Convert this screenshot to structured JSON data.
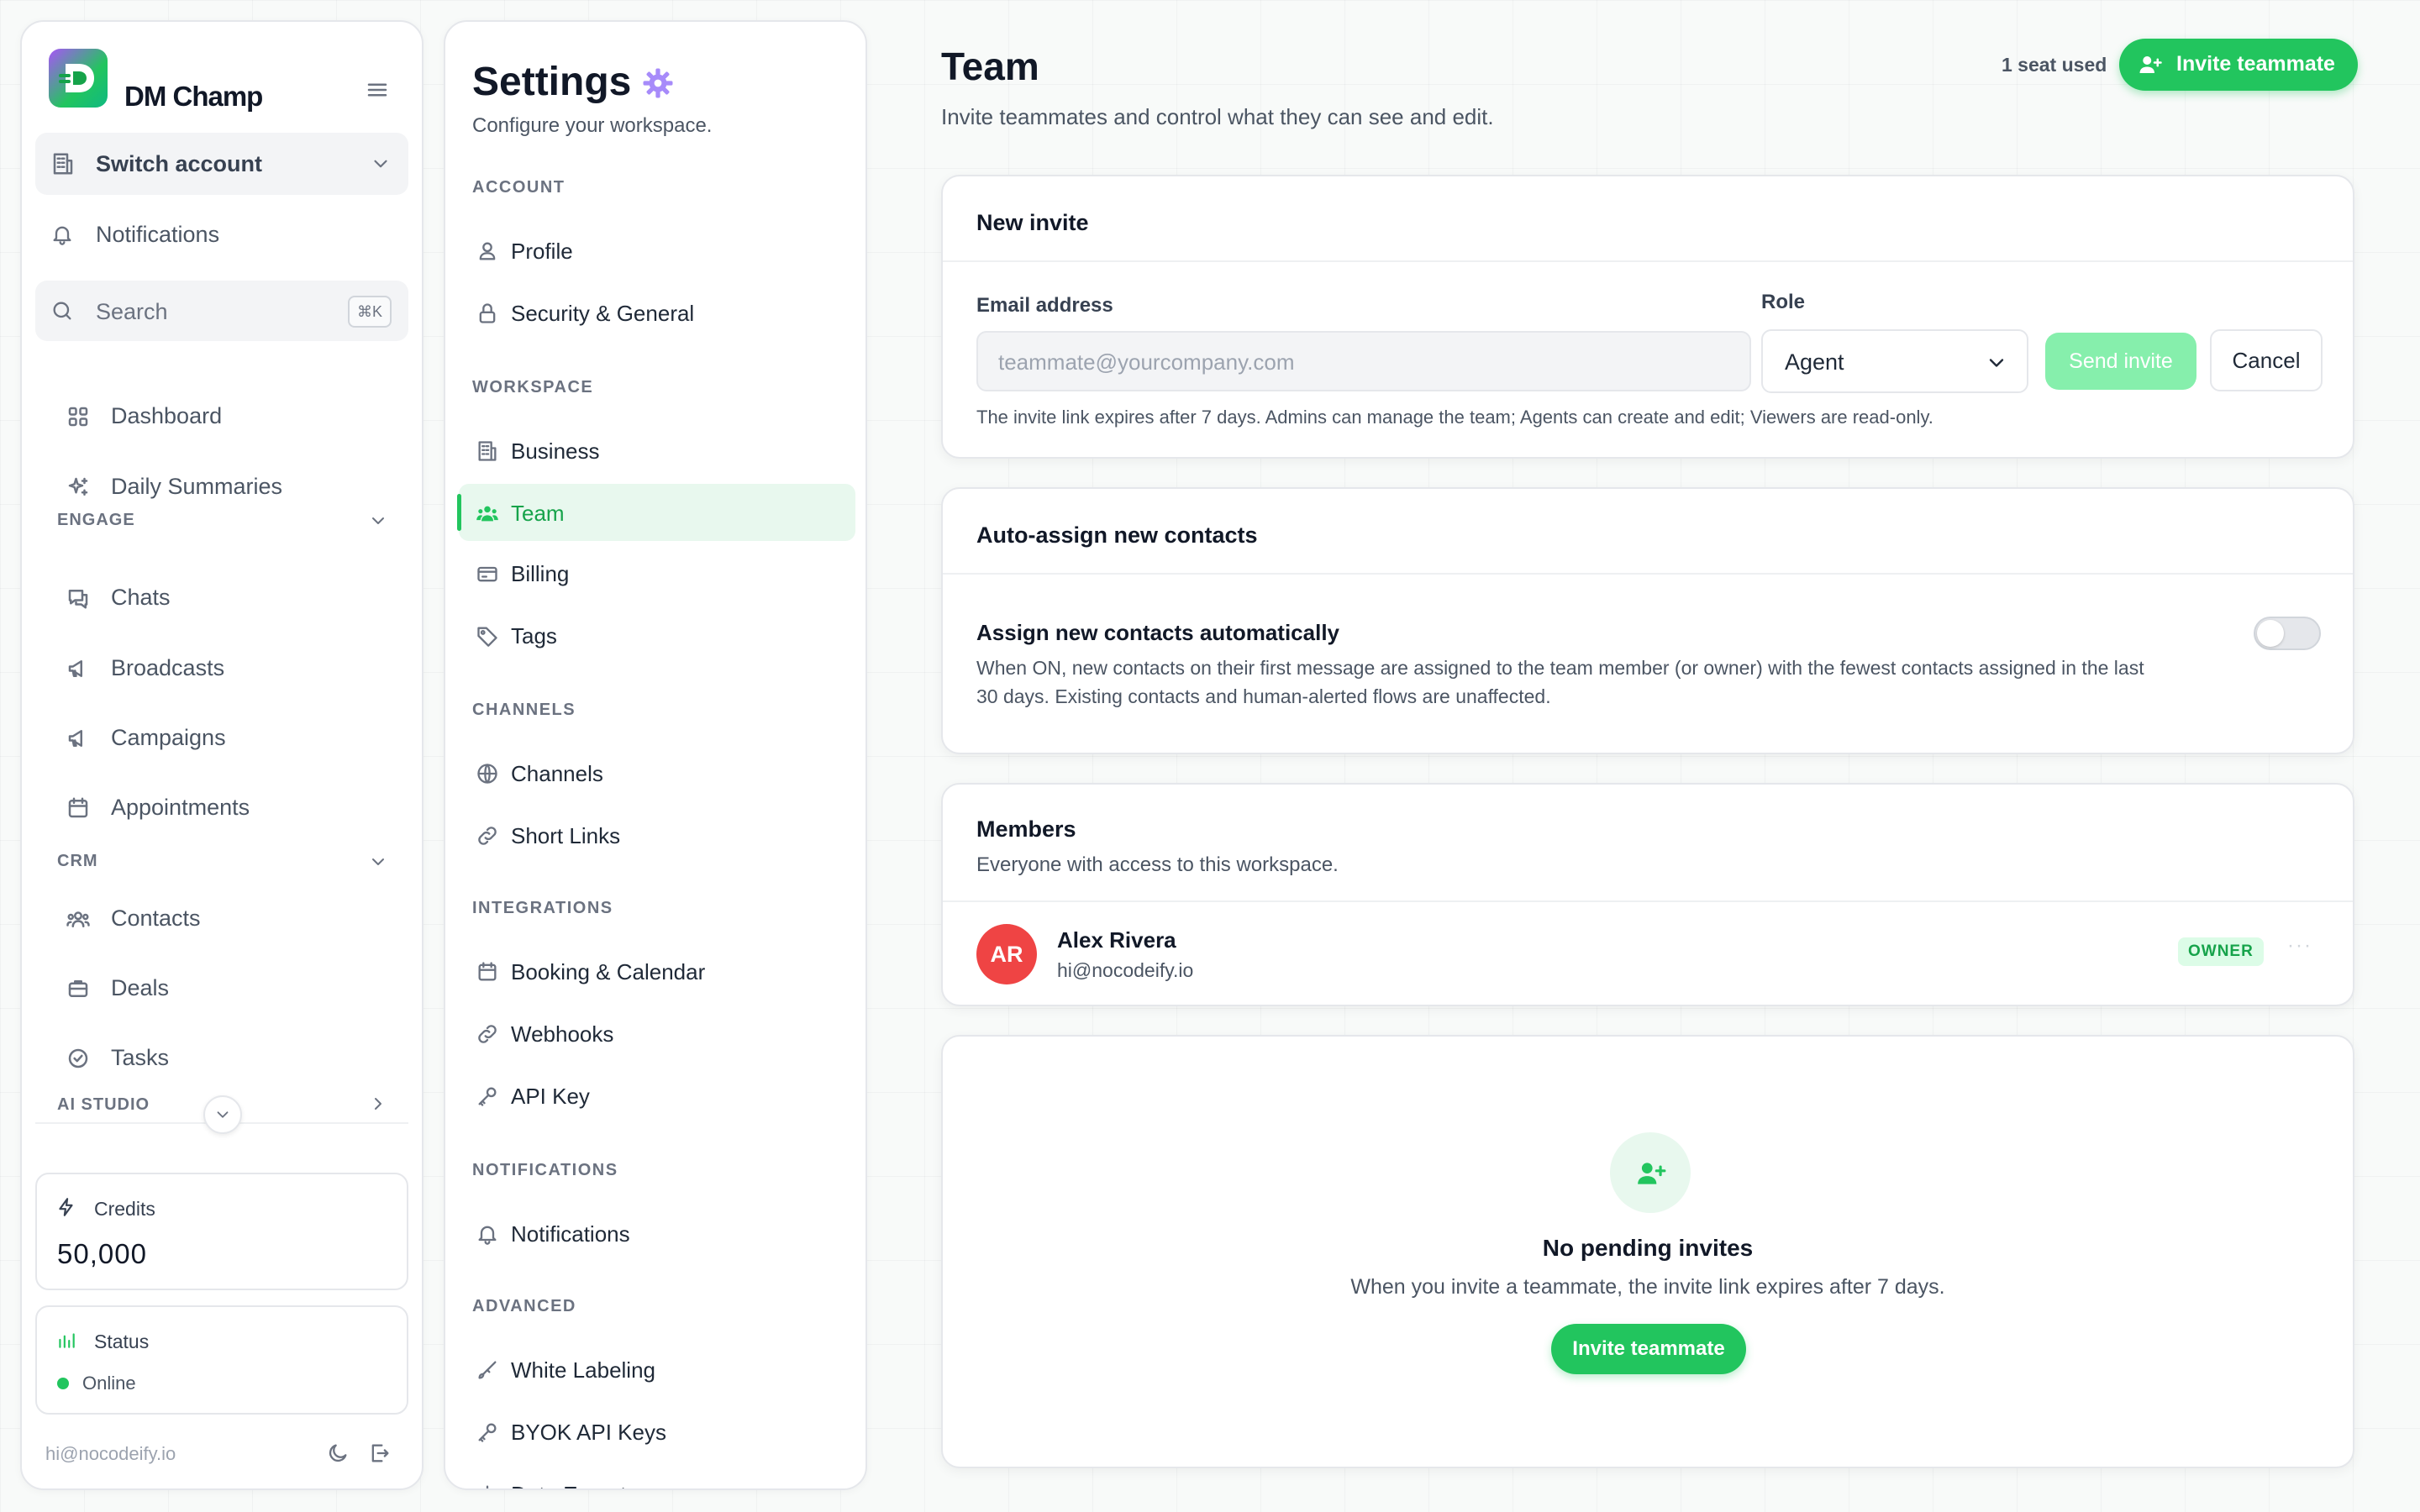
{
  "sidebar": {
    "brand": "DM Champ",
    "switch_account": "Switch account",
    "notifications": "Notifications",
    "search": {
      "label": "Search",
      "shortcut": "⌘K"
    },
    "items": [
      {
        "label": "Dashboard",
        "icon": "grid-icon"
      },
      {
        "label": "Daily Summaries",
        "icon": "sparkles-icon"
      }
    ],
    "sections": [
      {
        "label": "ENGAGE",
        "items": [
          {
            "label": "Chats",
            "icon": "chat-icon"
          },
          {
            "label": "Broadcasts",
            "icon": "megaphone-icon"
          },
          {
            "label": "Campaigns",
            "icon": "megaphone-icon"
          },
          {
            "label": "Appointments",
            "icon": "calendar-icon"
          }
        ]
      },
      {
        "label": "CRM",
        "items": [
          {
            "label": "Contacts",
            "icon": "users-icon"
          },
          {
            "label": "Deals",
            "icon": "briefcase-icon"
          },
          {
            "label": "Tasks",
            "icon": "check-circle-icon"
          }
        ]
      },
      {
        "label": "AI STUDIO",
        "items": []
      }
    ],
    "credits": {
      "label": "Credits",
      "value": "50,000"
    },
    "status": {
      "label": "Status",
      "value": "Online",
      "color": "#22c55e"
    },
    "footer_email": "hi@nocodeify.io"
  },
  "settings_nav": {
    "title": "Settings",
    "subtitle": "Configure your workspace.",
    "sections": [
      {
        "label": "ACCOUNT",
        "items": [
          "Profile",
          "Security & General"
        ]
      },
      {
        "label": "WORKSPACE",
        "items": [
          "Business",
          "Team",
          "Billing",
          "Tags"
        ]
      },
      {
        "label": "CHANNELS",
        "items": [
          "Channels",
          "Short Links"
        ]
      },
      {
        "label": "INTEGRATIONS",
        "items": [
          "Booking & Calendar",
          "Webhooks",
          "API Key"
        ]
      },
      {
        "label": "NOTIFICATIONS",
        "items": [
          "Notifications"
        ]
      },
      {
        "label": "ADVANCED",
        "items": [
          "White Labeling",
          "BYOK API Keys",
          "Data Export"
        ]
      }
    ],
    "active": "Team"
  },
  "header": {
    "title": "Team",
    "subtitle": "Invite teammates and control what they can see and edit.",
    "seats": "1 seat used",
    "invite_button": "Invite teammate"
  },
  "invite": {
    "title": "New invite",
    "email_label": "Email address",
    "email_placeholder": "teammate@yourcompany.com",
    "role_label": "Role",
    "role_value": "Agent",
    "send_button": "Send invite",
    "cancel_button": "Cancel",
    "hint": "The invite link expires after 7 days. Admins can manage the team; Agents can create and edit; Viewers are read-only."
  },
  "auto_assign": {
    "title": "Auto-assign new contacts",
    "toggle_label": "Assign new contacts automatically",
    "description_line1": "When ON, new contacts on their first message are assigned to the team member (or owner) with the fewest contacts assigned in the last",
    "description_line2": "30 days. Existing contacts and human-alerted flows are unaffected.",
    "enabled": false
  },
  "members": {
    "title": "Members",
    "subtitle": "Everyone with access to this workspace.",
    "list": [
      {
        "initials": "AR",
        "name": "Alex Rivera",
        "email": "hi@nocodeify.io",
        "role": "OWNER",
        "avatar_color": "#ef4444"
      }
    ]
  },
  "pending": {
    "title": "No pending invites",
    "subtitle": "When you invite a teammate, the invite link expires after 7 days.",
    "button": "Invite teammate"
  },
  "colors": {
    "accent": "#22c55e",
    "accent_dark": "#16a34a"
  }
}
